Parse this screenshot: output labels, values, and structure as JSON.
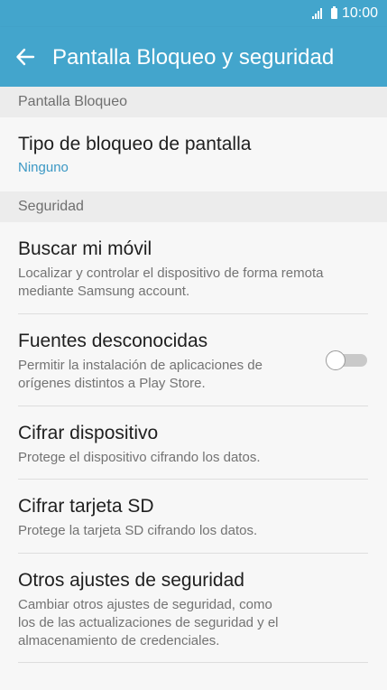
{
  "status_bar": {
    "time": "10:00",
    "icons": [
      "signal-icon",
      "battery-icon"
    ]
  },
  "app_bar": {
    "back_icon": "arrow-left-icon",
    "title": "Pantalla Bloqueo y seguridad"
  },
  "sections": [
    {
      "header": "Pantalla Bloqueo",
      "items": [
        {
          "title": "Tipo de bloqueo de pantalla",
          "subtitle": "Ninguno"
        }
      ]
    },
    {
      "header": "Seguridad",
      "items": [
        {
          "title": "Buscar mi móvil",
          "subtitle_lines": [
            "Localizar y controlar el dispositivo de forma remota",
            "mediante Samsung account."
          ]
        },
        {
          "title": "Fuentes desconocidas",
          "subtitle_lines": [
            "Permitir la instalación de aplicaciones de",
            "orígenes distintos a Play Store."
          ],
          "toggle_on": false
        },
        {
          "title": "Cifrar dispositivo",
          "subtitle_lines": [
            "Protege el dispositivo cifrando los datos."
          ]
        },
        {
          "title": "Cifrar tarjeta SD",
          "subtitle_lines": [
            "Protege la tarjeta SD cifrando los datos."
          ]
        },
        {
          "title": "Otros ajustes de seguridad",
          "subtitle_lines": [
            "Cambiar otros ajustes de seguridad, como",
            "los de las actualizaciones de seguridad y el",
            "almacenamiento de credenciales."
          ]
        }
      ]
    }
  ],
  "colors": {
    "app_bar": "#43a5cc",
    "accent_text": "#3b98c4",
    "background": "#f7f7f7",
    "section_header_bg": "#ececec"
  }
}
